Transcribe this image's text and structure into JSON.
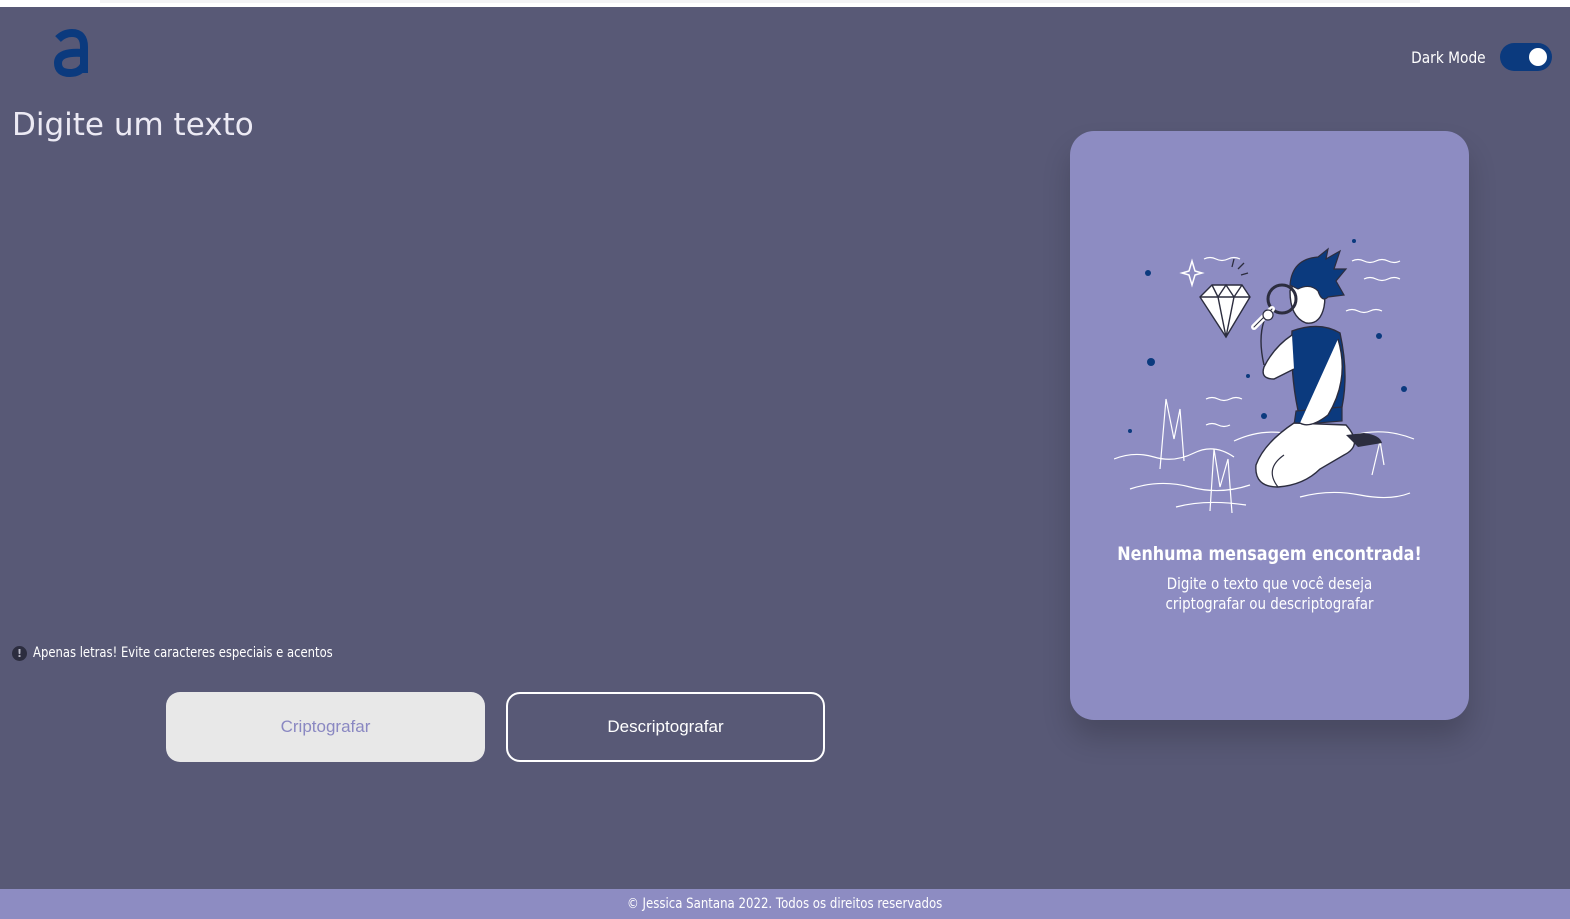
{
  "header": {
    "logo_icon": "letter-a-logo",
    "dark_mode_label": "Dark Mode",
    "dark_mode_on": true
  },
  "editor": {
    "placeholder": "Digite um texto",
    "value": ""
  },
  "hint": {
    "icon": "exclamation-icon",
    "text": "Apenas letras! Evite caracteres especiais e acentos"
  },
  "actions": {
    "encrypt_label": "Criptografar",
    "decrypt_label": "Descriptografar"
  },
  "output_panel": {
    "illustration": "person-inspecting-diamond-with-magnifier",
    "title": "Nenhuma mensagem encontrada!",
    "text": "Digite o texto que você deseja criptografar ou descriptografar"
  },
  "footer": {
    "text": "© Jessica Santana 2022. Todos os direitos reservados"
  },
  "colors": {
    "background": "#585976",
    "panel": "#8d8cc2",
    "accent": "#0b3a7e",
    "button_light": "#e8e8e8"
  }
}
